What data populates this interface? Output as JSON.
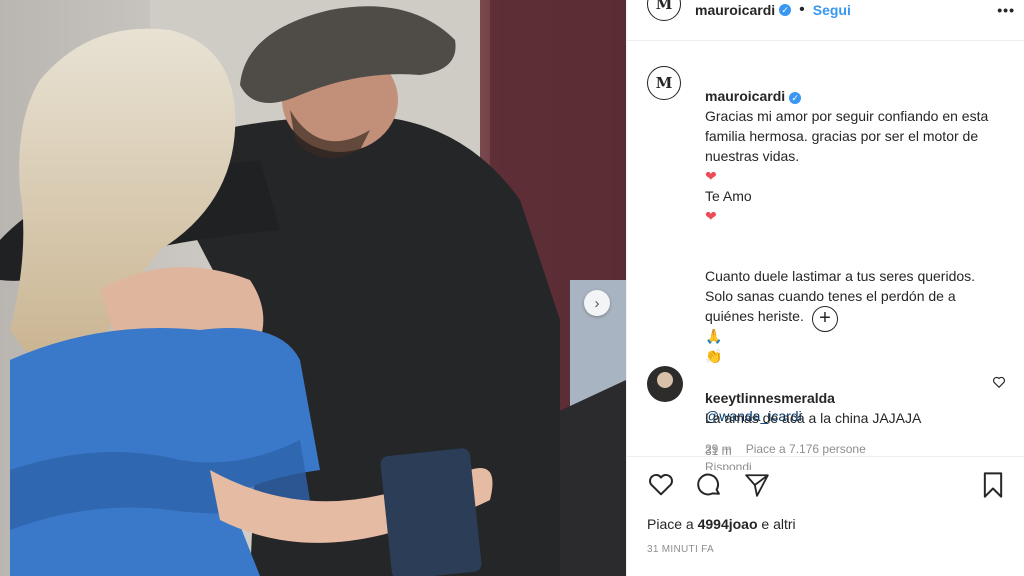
{
  "post": {
    "username": "mauroicardi",
    "logo_text": "M",
    "follow_label": "Segui",
    "more_label": "•••",
    "caption_line1": "Gracias mi amor por seguir confiando en esta familia hermosa. gracias por ser el motor de nuestras vidas.",
    "caption_love": "Te Amo",
    "caption_line2": "Cuanto duele lastimar a tus seres queridos. Solo sanas cuando tenes el perdón de a quiénes heriste.",
    "mention": "@wanda_icardi",
    "caption_time": "31 m"
  },
  "comment": {
    "username": "keeytlinnesmeralda",
    "text": "La amas de acá a la china JAJAJA",
    "time": "29 m",
    "likes": "Piace a 7.176 persone",
    "reply": "Rispondi"
  },
  "actions": {
    "likes_prefix": "Piace a ",
    "likes_user": "4994joao",
    "likes_suffix": " e altri",
    "timestamp": "31 MINUTI FA"
  },
  "colors": {
    "accent": "#3897f0",
    "heart": "#ed4956",
    "dress": "#3a78c9"
  }
}
